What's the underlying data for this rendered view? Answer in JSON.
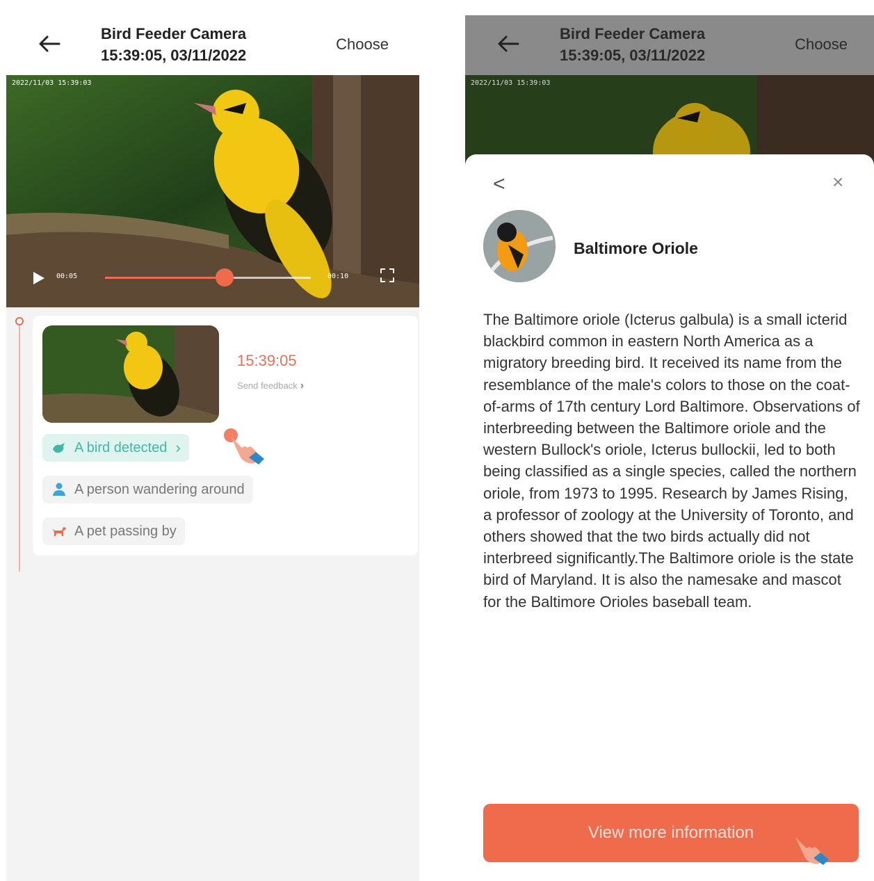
{
  "left": {
    "header": {
      "title": "Bird Feeder Camera",
      "subtitle": "15:39:05, 03/11/2022",
      "choose_label": "Choose"
    },
    "video": {
      "stamp": "2022/11/03 15:39:03",
      "current_time": "00:05",
      "end_time": "00:10",
      "progress": 0.58
    },
    "event": {
      "time": "15:39:05",
      "feedback_label": "Send feedback",
      "chips": [
        {
          "label": "A bird detected",
          "icon": "bird-icon",
          "color": "#3fb8a6"
        },
        {
          "label": "A person wandering around",
          "icon": "person-icon",
          "color": "#3fa5d8"
        },
        {
          "label": "A pet passing by",
          "icon": "dog-icon",
          "color": "#f06a4c"
        }
      ]
    }
  },
  "right": {
    "header": {
      "title": "Bird Feeder Camera",
      "subtitle": "15:39:05, 03/11/2022",
      "choose_label": "Choose"
    },
    "video": {
      "stamp": "2022/11/03 15:39:03"
    },
    "sheet": {
      "back_glyph": "<",
      "close_glyph": "×",
      "species_name": "Baltimore Oriole",
      "description": "The Baltimore oriole (Icterus galbula) is a small icterid blackbird common in eastern North America as a migratory breeding bird. It received its name from the resemblance of the male's colors to those on the coat-of-arms of 17th century Lord Baltimore. Observations of interbreeding between the Baltimore oriole and the western Bullock's oriole, Icterus bullockii, led to both being classified as a single species, called the northern oriole, from 1973 to 1995. Research by James Rising, a professor of zoology at the University of Toronto, and others showed that the two birds actually did not interbreed significantly.The Baltimore oriole is the state bird of Maryland. It is also the namesake and mascot for the Baltimore Orioles baseball team.",
      "view_more_label": "View more information"
    }
  },
  "colors": {
    "accent": "#f06a4c",
    "teal": "#3fb8a6",
    "watermark": "#9fd470"
  }
}
